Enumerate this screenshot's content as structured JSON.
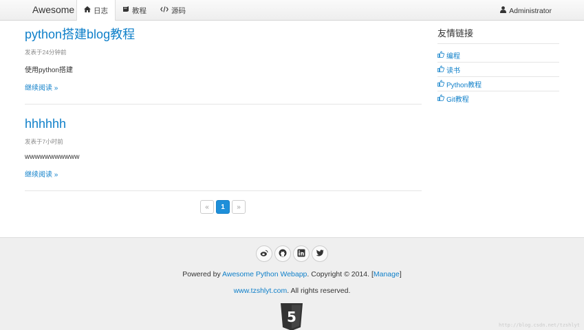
{
  "navbar": {
    "brand": "Awesome",
    "items": [
      {
        "label": "日志",
        "icon": "home-icon",
        "active": true
      },
      {
        "label": "教程",
        "icon": "book-icon",
        "active": false
      },
      {
        "label": "源码",
        "icon": "code-icon",
        "active": false
      }
    ],
    "user": {
      "label": "Administrator",
      "icon": "user-icon"
    }
  },
  "posts": [
    {
      "title": "python搭建blog教程",
      "meta": "发表于24分钟前",
      "summary": "使用python搭建",
      "more": "继续阅读 »"
    },
    {
      "title": "hhhhhh",
      "meta": "发表于7小时前",
      "summary": "wwwwwwwwwww",
      "more": "继续阅读 »"
    }
  ],
  "pagination": {
    "prev": "«",
    "current": "1",
    "next": "»"
  },
  "sidebar": {
    "title": "友情链接",
    "links": [
      "编程",
      "读书",
      "Python教程",
      "Git教程"
    ]
  },
  "footer": {
    "social": [
      "weibo-icon",
      "github-icon",
      "linkedin-icon",
      "twitter-icon"
    ],
    "powered_prefix": "Powered by ",
    "powered_link": "Awesome Python Webapp",
    "copyright": ". Copyright © 2014. [",
    "manage_link": "Manage",
    "manage_suffix": "]",
    "site_link": "www.tzshlyt.com",
    "rights": ". All rights reserved.",
    "badge_text": "5"
  },
  "watermark": "http://blog.csdn.net/tzshlyt",
  "colors": {
    "link": "#0e7fc9",
    "active_page": "#1e8fd9",
    "footer_bg": "#efefef"
  }
}
